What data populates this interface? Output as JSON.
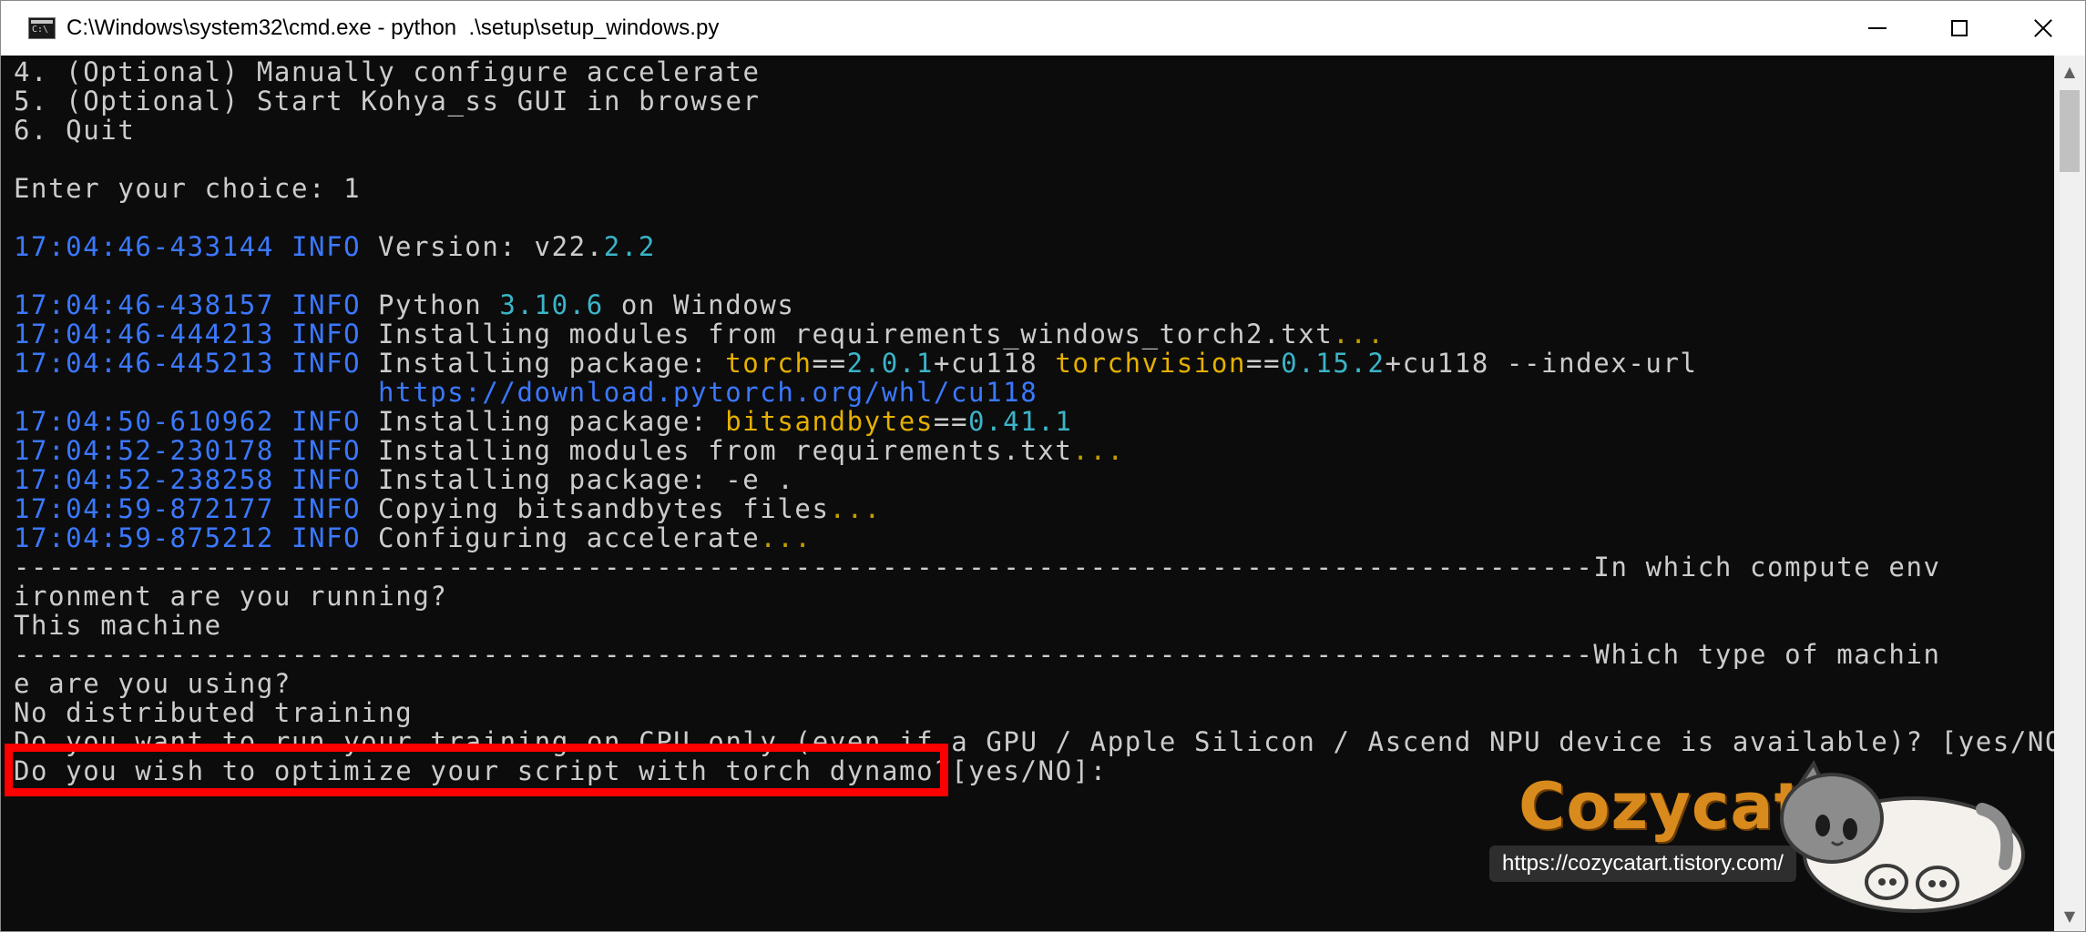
{
  "window": {
    "title": "C:\\Windows\\system32\\cmd.exe - python  .\\setup\\setup_windows.py"
  },
  "console": {
    "menu_lines": [
      "4. (Optional) Manually configure accelerate",
      "5. (Optional) Start Kohya_ss GUI in browser",
      "6. Quit"
    ],
    "prompt": "Enter your choice: 1",
    "log": [
      {
        "ts": "17:04:46-433144",
        "lvl": "INFO",
        "segments": [
          [
            "Version: v22.",
            ""
          ],
          [
            "2.2",
            "cyan"
          ]
        ]
      },
      {
        "ts": "17:04:46-438157",
        "lvl": "INFO",
        "segments": [
          [
            "Python ",
            ""
          ],
          [
            "3.10.6",
            "cyan"
          ],
          [
            " on Windows",
            ""
          ]
        ]
      },
      {
        "ts": "17:04:46-444213",
        "lvl": "INFO",
        "segments": [
          [
            "Installing modules from requirements_windows_torch2.txt",
            ""
          ],
          [
            "...",
            "gold"
          ]
        ]
      },
      {
        "ts": "17:04:46-445213",
        "lvl": "INFO",
        "segments": [
          [
            "Installing package: ",
            ""
          ],
          [
            "torch",
            "yel"
          ],
          [
            "==",
            ""
          ],
          [
            "2.0.1",
            "cyan"
          ],
          [
            "+cu118 ",
            ""
          ],
          [
            "torchvision",
            "yel"
          ],
          [
            "==",
            ""
          ],
          [
            "0.15.2",
            "cyan"
          ],
          [
            "+cu118 --index-url",
            ""
          ]
        ]
      },
      {
        "ts": "",
        "lvl": "",
        "segments": [
          [
            "https://download.pytorch.org/whl/cu118",
            "blue"
          ]
        ]
      },
      {
        "ts": "17:04:50-610962",
        "lvl": "INFO",
        "segments": [
          [
            "Installing package: ",
            ""
          ],
          [
            "bitsandbytes",
            "yel"
          ],
          [
            "==",
            ""
          ],
          [
            "0.41.1",
            "cyan"
          ]
        ]
      },
      {
        "ts": "17:04:52-230178",
        "lvl": "INFO",
        "segments": [
          [
            "Installing modules from requirements.txt",
            ""
          ],
          [
            "...",
            "gold"
          ]
        ]
      },
      {
        "ts": "17:04:52-238258",
        "lvl": "INFO",
        "segments": [
          [
            "Installing package: -e .",
            ""
          ]
        ]
      },
      {
        "ts": "17:04:59-872177",
        "lvl": "INFO",
        "segments": [
          [
            "Copying bitsandbytes files",
            ""
          ],
          [
            "...",
            "gold"
          ]
        ]
      },
      {
        "ts": "17:04:59-875212",
        "lvl": "INFO",
        "segments": [
          [
            "Configuring accelerate",
            ""
          ],
          [
            "...",
            "gold"
          ]
        ]
      }
    ],
    "divider_1": "-------------------------------------------------------------------------------------------In which compute env",
    "q1_cont": "ironment are you running?",
    "a1": "This machine",
    "divider_2": "-------------------------------------------------------------------------------------------Which type of machin",
    "q2_cont": "e are you using?",
    "a2": "No distributed training",
    "q3": "Do you want to run your training on CPU only (even if a GPU / Apple Silicon / Ascend NPU device is available)? [yes/NO]no",
    "q4": "Do you wish to optimize your script with torch dynamo?[yes/NO]:"
  },
  "watermark": {
    "brand": "Cozycat",
    "url": "https://cozycatart.tistory.com/"
  },
  "colors": {
    "console_bg": "#0c0c0c",
    "text": "#cccccc",
    "timestamp": "#3b78ff",
    "number": "#3bb4c8",
    "package": "#e5b000",
    "highlight_box": "#ff0000"
  }
}
